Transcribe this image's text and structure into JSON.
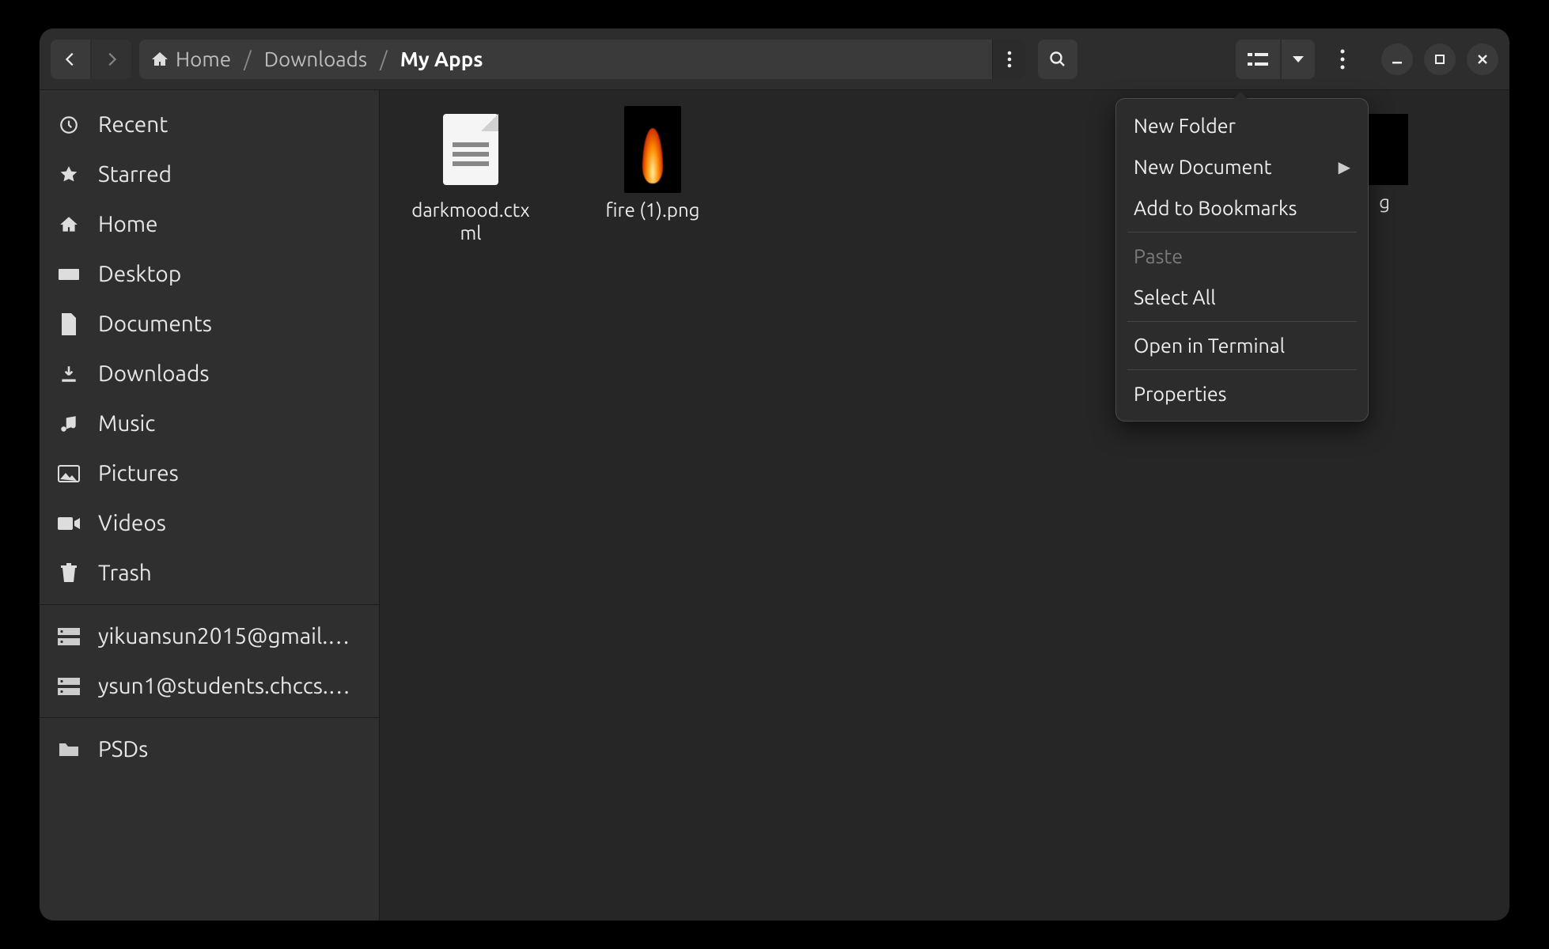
{
  "breadcrumb": {
    "home": "Home",
    "downloads": "Downloads",
    "current": "My Apps"
  },
  "sidebar": {
    "items": [
      {
        "label": "Recent"
      },
      {
        "label": "Starred"
      },
      {
        "label": "Home"
      },
      {
        "label": "Desktop"
      },
      {
        "label": "Documents"
      },
      {
        "label": "Downloads"
      },
      {
        "label": "Music"
      },
      {
        "label": "Pictures"
      },
      {
        "label": "Videos"
      },
      {
        "label": "Trash"
      }
    ],
    "accounts": [
      {
        "label": "yikuansun2015@gmail.…"
      },
      {
        "label": "ysun1@students.chccs.…"
      }
    ],
    "extra": [
      {
        "label": "PSDs"
      }
    ]
  },
  "files": [
    {
      "name": "darkmood.ctxml",
      "kind": "doc"
    },
    {
      "name": "fire (1).png",
      "kind": "fire"
    }
  ],
  "peek_file_suffix": "g",
  "context_menu": {
    "new_folder": "New Folder",
    "new_document": "New Document",
    "add_bookmarks": "Add to Bookmarks",
    "paste": "Paste",
    "select_all": "Select All",
    "open_terminal": "Open in Terminal",
    "properties": "Properties"
  }
}
